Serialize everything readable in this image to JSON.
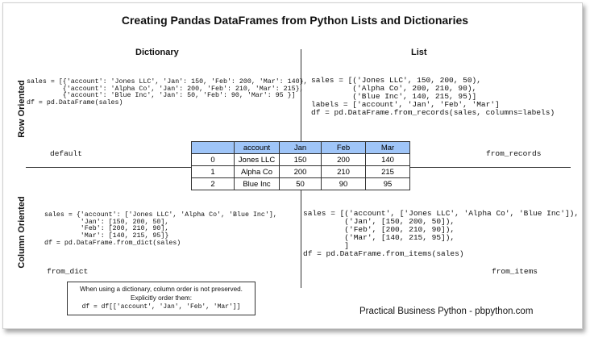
{
  "title": "Creating Pandas DataFrames from Python Lists and Dictionaries",
  "columns": {
    "dictionary": "Dictionary",
    "list": "List"
  },
  "rows": {
    "row_oriented": "Row Oriented",
    "column_oriented": "Column Oriented"
  },
  "quadrants": {
    "dict_row": {
      "code": "sales = [{'account': 'Jones LLC', 'Jan': 150, 'Feb': 200, 'Mar': 140},\n         {'account': 'Alpha Co', 'Jan': 200, 'Feb': 210, 'Mar': 215},\n         {'account': 'Blue Inc', 'Jan': 50, 'Feb': 90, 'Mar': 95 }]\ndf = pd.DataFrame(sales)",
      "method": "default"
    },
    "list_row": {
      "code": "sales = [('Jones LLC', 150, 200, 50),\n         ('Alpha Co', 200, 210, 90),\n         ('Blue Inc', 140, 215, 95)]\nlabels = ['account', 'Jan', 'Feb', 'Mar']\ndf = pd.DataFrame.from_records(sales, columns=labels)",
      "method": "from_records"
    },
    "dict_col": {
      "code": "sales = {'account': ['Jones LLC', 'Alpha Co', 'Blue Inc'],\n         'Jan': [150, 200, 50],\n         'Feb': [200, 210, 90],\n         'Mar': [140, 215, 95]}\ndf = pd.DataFrame.from_dict(sales)",
      "method": "from_dict"
    },
    "list_col": {
      "code": "sales = [('account', ['Jones LLC', 'Alpha Co', 'Blue Inc']),\n         ('Jan', [150, 200, 50]),\n         ('Feb', [200, 210, 90]),\n         ('Mar', [140, 215, 95]),\n         ]\ndf = pd.DataFrame.from_items(sales)",
      "method": "from_items"
    }
  },
  "table": {
    "headers": [
      "",
      "account",
      "Jan",
      "Feb",
      "Mar"
    ],
    "rows": [
      [
        "0",
        "Jones LLC",
        "150",
        "200",
        "140"
      ],
      [
        "1",
        "Alpha Co",
        "200",
        "210",
        "215"
      ],
      [
        "2",
        "Blue Inc",
        "50",
        "90",
        "95"
      ]
    ]
  },
  "note": {
    "line1": "When using a dictionary, column order is not preserved.",
    "line2": "Explicitly order them:",
    "line3": "df = df[['account', 'Jan', 'Feb', 'Mar']]"
  },
  "footer": "Practical Business Python - pbpython.com",
  "colors": {
    "table_header": "#9fc5f8",
    "line": "#333333"
  }
}
